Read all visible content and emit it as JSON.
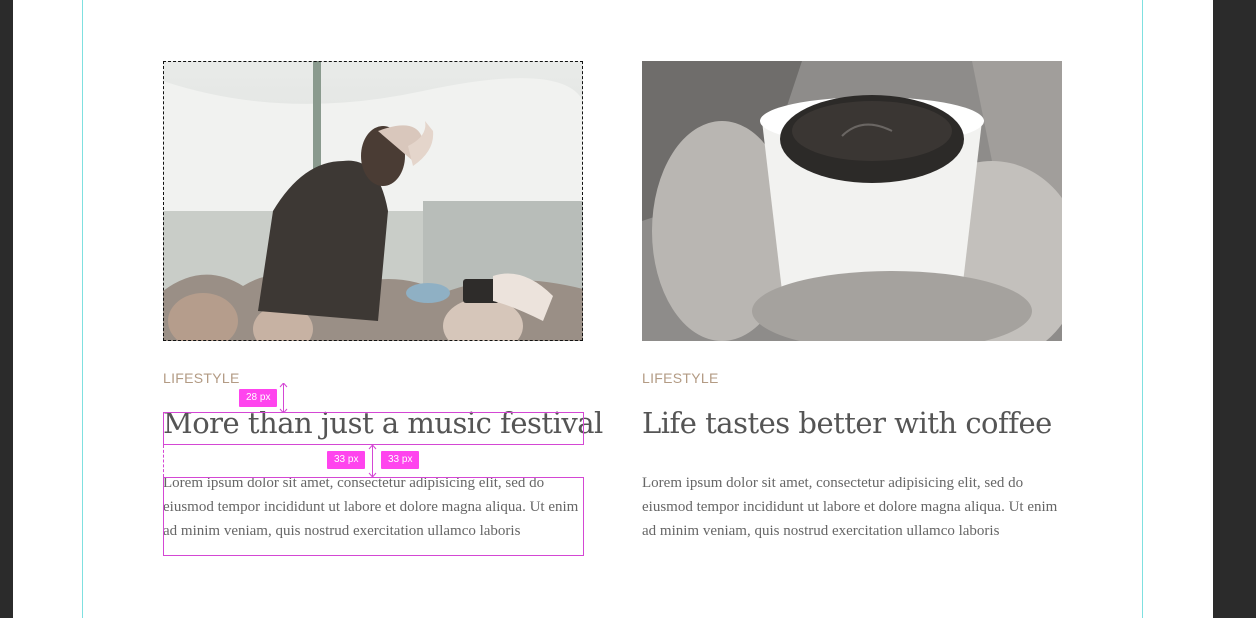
{
  "cards": [
    {
      "category": "LIFESTYLE",
      "title": "More than just a music festival",
      "excerpt": "Lorem ipsum dolor sit amet, consectetur adipisicing elit, sed do eiusmod tempor incididunt ut labore et dolore magna aliqua. Ut enim ad minim veniam, quis nostrud exercitation ullamco laboris",
      "image": "concert-crowd-photo",
      "selected": true
    },
    {
      "category": "LIFESTYLE",
      "title": "Life tastes better with coffee",
      "excerpt": "Lorem ipsum dolor sit amet, consectetur adipisicing elit, sed do eiusmod tempor incididunt ut labore et dolore magna aliqua. Ut enim ad minim veniam, quis nostrud exercitation ullamco laboris",
      "image": "coffee-mug-in-mittens-photo",
      "selected": false
    }
  ],
  "measurements": {
    "category_to_title": "28 px",
    "title_to_body_a": "33 px",
    "title_to_body_b": "33 px"
  },
  "colors": {
    "guide": "#7fe0e0",
    "measure": "#ff44ee",
    "category": "#b39b84"
  }
}
